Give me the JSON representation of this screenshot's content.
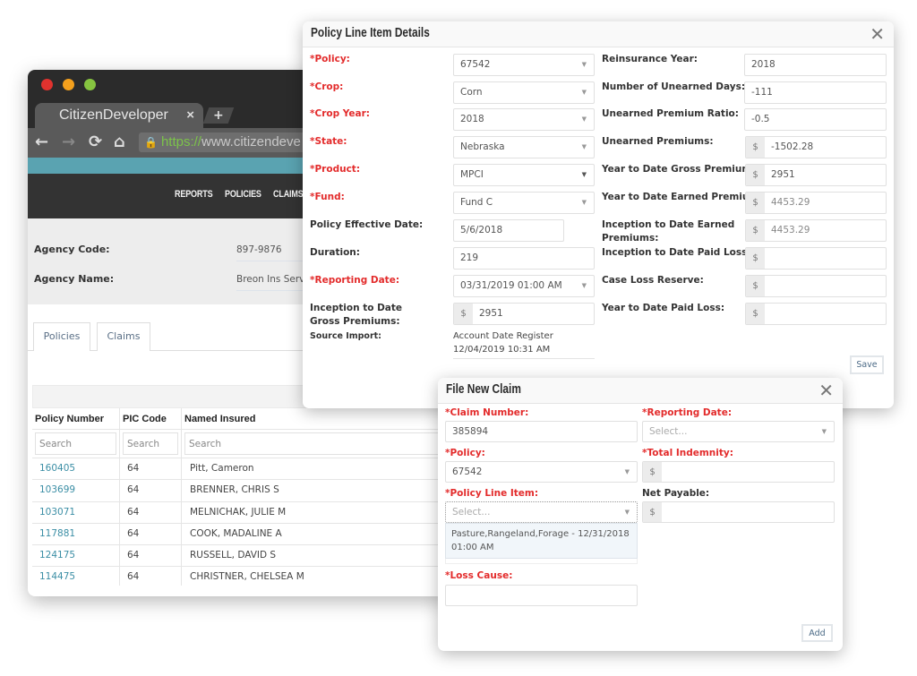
{
  "browser": {
    "tab_title": "CitizenDeveloper",
    "tab_close": "×",
    "tab_new": "+",
    "nav": {
      "back": "←",
      "forward": "→",
      "reload": "⟳",
      "home": "⌂"
    },
    "url_lock": "🔒",
    "url_scheme": "https://",
    "url_host": "www.citizendeve"
  },
  "site": {
    "nav_items": [
      "REPORTS",
      "POLICIES",
      "CLAIMS"
    ],
    "colors": {
      "teal_bar": "#5aa3b1",
      "header": "#333333"
    },
    "agency": {
      "code_label": "Agency Code:",
      "code_value": "897-9876",
      "name_label": "Agency Name:",
      "name_value": "Breon Ins Serv"
    },
    "tabs": [
      "Policies",
      "Claims"
    ],
    "grid": {
      "columns": [
        "Policy Number",
        "PIC Code",
        "Named Insured"
      ],
      "search_placeholder": "Search",
      "rows": [
        {
          "policy": "160405",
          "pic": "64",
          "insured": "Pitt, Cameron"
        },
        {
          "policy": "103699",
          "pic": "64",
          "insured": "BRENNER, CHRIS S"
        },
        {
          "policy": "103071",
          "pic": "64",
          "insured": "MELNICHAK, JULIE M"
        },
        {
          "policy": "117881",
          "pic": "64",
          "insured": "COOK, MADALINE A"
        },
        {
          "policy": "124175",
          "pic": "64",
          "insured": "RUSSELL, DAVID S"
        },
        {
          "policy": "114475",
          "pic": "64",
          "insured": "CHRISTNER, CHELSEA M"
        }
      ]
    }
  },
  "policy_modal": {
    "title": "Policy Line Item Details",
    "close": "✕",
    "left": [
      {
        "label": "*Policy:",
        "value": "67542",
        "type": "select",
        "required": true
      },
      {
        "label": "*Crop:",
        "value": "Corn",
        "type": "select",
        "required": true
      },
      {
        "label": "*Crop Year:",
        "value": "2018",
        "type": "select",
        "required": true
      },
      {
        "label": "*State:",
        "value": "Nebraska",
        "type": "select",
        "required": true
      },
      {
        "label": "*Product:",
        "value": "MPCI",
        "type": "select",
        "required": true
      },
      {
        "label": "*Fund:",
        "value": "Fund C",
        "type": "select",
        "required": true
      },
      {
        "label": "Policy Effective Date:",
        "value": "5/6/2018",
        "type": "date"
      },
      {
        "label": "Duration:",
        "value": "219",
        "type": "text"
      },
      {
        "label": "*Reporting Date:",
        "value": "03/31/2019 01:00 AM",
        "type": "select",
        "required": true
      },
      {
        "label": "Inception to Date Gross Premiums:",
        "value": "2951",
        "type": "money"
      }
    ],
    "source_import": {
      "label": "Source Import:",
      "line1": "Account Date Register",
      "line2": "12/04/2019 10:31 AM"
    },
    "right": [
      {
        "label": "Reinsurance Year:",
        "value": "2018",
        "type": "text"
      },
      {
        "label": "Number of Unearned Days:",
        "value": "-111",
        "type": "text"
      },
      {
        "label": "Unearned Premium Ratio:",
        "value": "-0.5",
        "type": "text"
      },
      {
        "label": "Unearned Premiums:",
        "value": "-1502.28",
        "type": "money"
      },
      {
        "label": "Year to Date Gross Premiums:",
        "value": "2951",
        "type": "money"
      },
      {
        "label": "Year to Date Earned Premiums:",
        "value": "4453.29",
        "type": "money"
      },
      {
        "label": "Inception to Date Earned Premiums:",
        "value": "4453.29",
        "type": "money"
      },
      {
        "label": "Inception to Date Paid Loss:",
        "value": "",
        "type": "money"
      },
      {
        "label": "Case Loss Reserve:",
        "value": "",
        "type": "money"
      },
      {
        "label": "Year to Date Paid Loss:",
        "value": "",
        "type": "money"
      }
    ],
    "currency_symbol": "$",
    "caret": "▼",
    "save_label": "Save"
  },
  "claim_modal": {
    "title": "File New Claim",
    "close": "✕",
    "claim_number": {
      "label": "*Claim Number:",
      "value": "385894"
    },
    "reporting_date": {
      "label": "*Reporting Date:",
      "placeholder": "Select..."
    },
    "policy": {
      "label": "*Policy:",
      "value": "67542"
    },
    "total_indemnity": {
      "label": "*Total Indemnity:",
      "value": ""
    },
    "policy_line_item": {
      "label": "*Policy Line Item:",
      "placeholder": "Select...",
      "options": [
        "Pasture,Rangeland,Forage - 12/31/2018 01:00 AM"
      ]
    },
    "net_payable": {
      "label": "Net Payable:",
      "value": ""
    },
    "loss_cause": {
      "label": "*Loss Cause:",
      "value": ""
    },
    "currency_symbol": "$",
    "caret": "▼",
    "add_label": "Add",
    "required_color": "#e32b2b"
  }
}
